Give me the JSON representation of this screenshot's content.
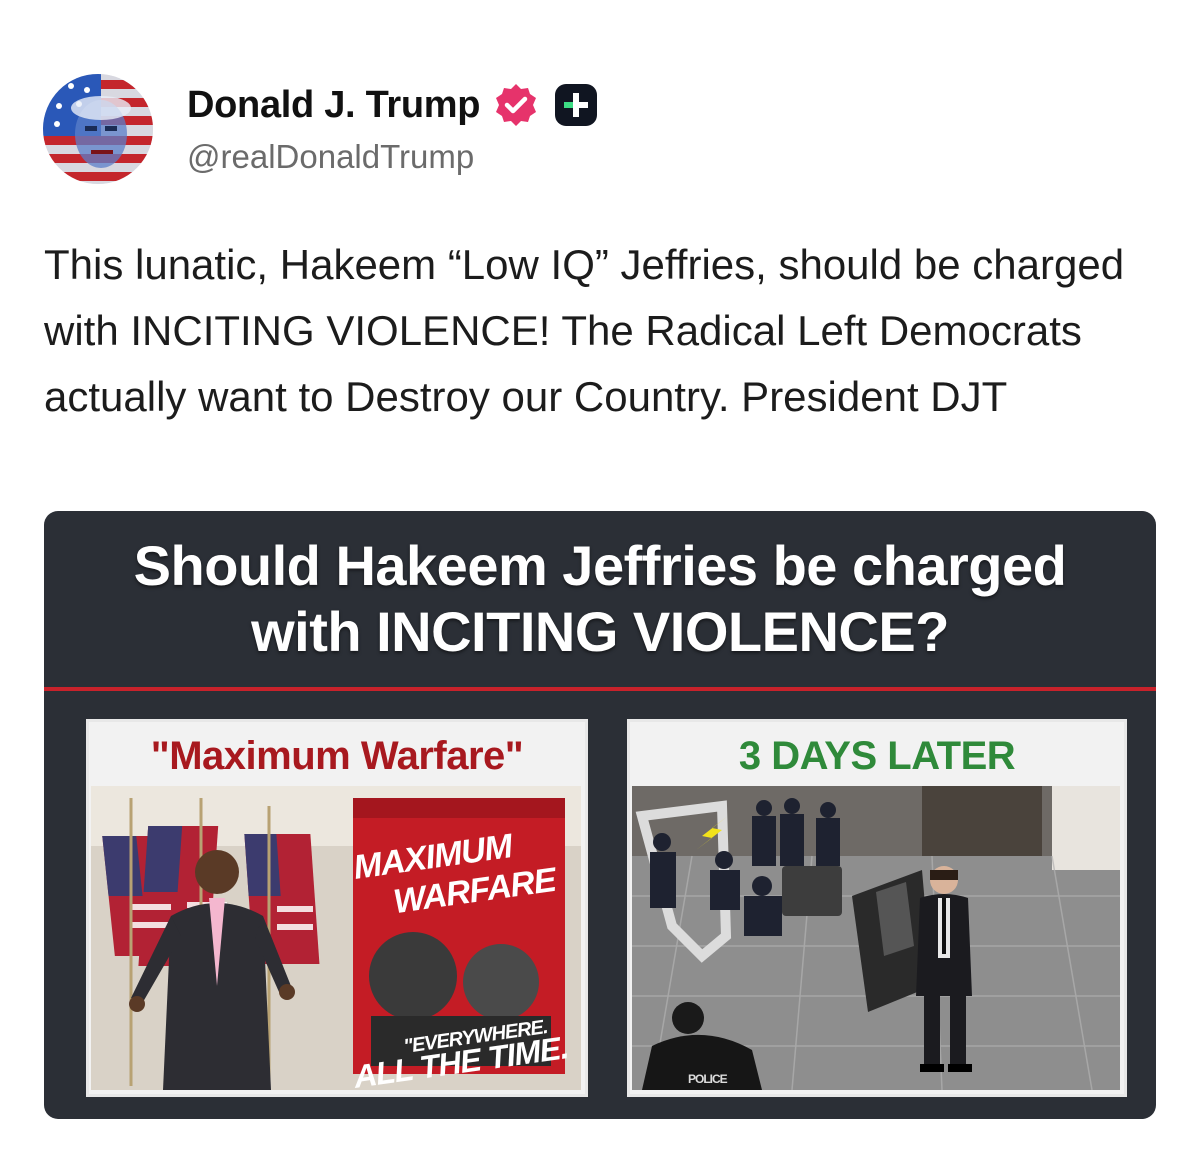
{
  "author": {
    "display_name": "Donald J. Trump",
    "handle": "@realDonaldTrump",
    "verified_color": "#e6336b",
    "badge_color": "#101521"
  },
  "post": {
    "text": "This lunatic, Hakeem “Low IQ” Jeffries, should be charged with INCITING VIOLENCE! The Radical Left Democrats actually want to Destroy our Country. President DJT"
  },
  "graphic": {
    "title_line1": "Should Hakeem Jeffries be charged",
    "title_line2": "with INCITING VIOLENCE?",
    "left_caption": "\"Maximum Warfare\"",
    "right_caption": "3 DAYS LATER",
    "poster_line1": "MAXIMUM",
    "poster_line2": "WARFARE",
    "poster_line3": "\"EVERYWHERE.",
    "poster_line4": "ALL THE TIME.",
    "police_label": "POLICE",
    "colors": {
      "background": "#2b2f36",
      "divider": "#c8222b",
      "left_caption": "#a8191f",
      "right_caption": "#2f8a3a"
    }
  }
}
